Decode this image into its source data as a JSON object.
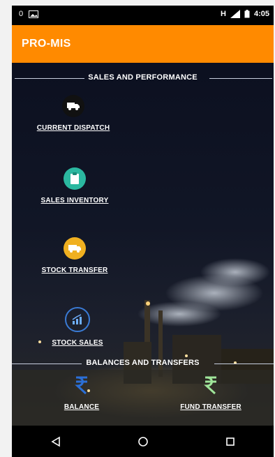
{
  "status_bar": {
    "left_badge": "0",
    "network": "H",
    "time": "4:05"
  },
  "app_bar": {
    "title": "PRO-MIS"
  },
  "sections": {
    "sales": {
      "title": "SALES AND PERFORMANCE",
      "items": [
        {
          "label": "CURRENT DISPATCH",
          "icon": "truck-icon",
          "color": "#111111"
        },
        {
          "label": "SALES INVENTORY",
          "icon": "clipboard-icon",
          "color": "#2bb8a0"
        },
        {
          "label": "STOCK TRANSFER",
          "icon": "transfer-truck-icon",
          "color": "#f0b020"
        },
        {
          "label": "STOCK SALES",
          "icon": "chart-up-icon",
          "color": "#3a7bd5"
        }
      ]
    },
    "balances": {
      "title": "BALANCES AND TRANSFERS",
      "items": [
        {
          "label": "BALANCE",
          "icon": "rupee-icon",
          "color": "#2b6fd6"
        },
        {
          "label": "FUND TRANSFER",
          "icon": "rupee-icon",
          "color": "#7fd17a"
        }
      ]
    }
  },
  "nav_bar": {
    "back": "back-icon",
    "home": "home-icon",
    "recents": "recents-icon"
  }
}
